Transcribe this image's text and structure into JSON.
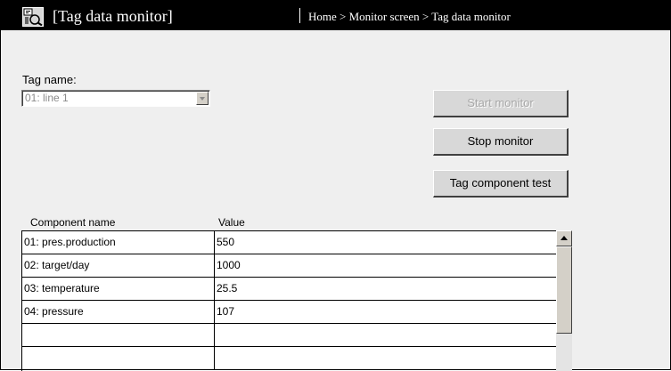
{
  "window": {
    "title": "[Tag data monitor]",
    "breadcrumb": "Home > Monitor screen > Tag data monitor",
    "icon": "tag-icon"
  },
  "form": {
    "tag_label": "Tag name:",
    "tag_value": "01: line 1"
  },
  "buttons": {
    "start": "Start monitor",
    "stop": "Stop monitor",
    "test": "Tag component test"
  },
  "table": {
    "headers": [
      "Component name",
      "Value"
    ],
    "rows": [
      [
        "01: pres.production",
        "550"
      ],
      [
        "02: target/day",
        "1000"
      ],
      [
        "03: temperature",
        "25.5"
      ],
      [
        "04: pressure",
        "107"
      ],
      [
        "",
        ""
      ],
      [
        "",
        ""
      ]
    ]
  }
}
